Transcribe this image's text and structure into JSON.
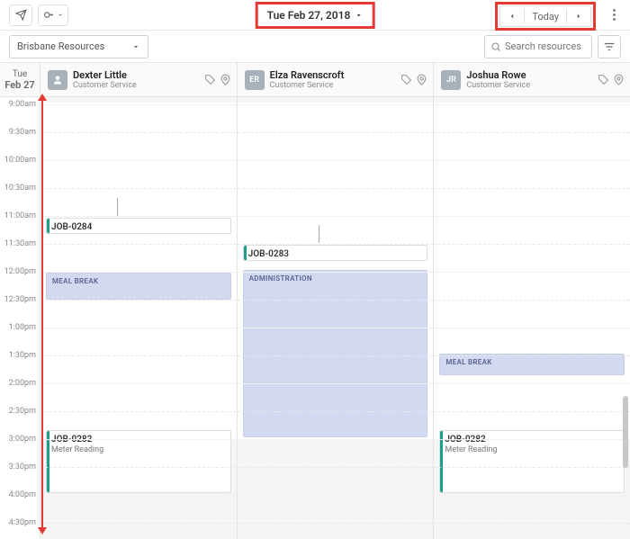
{
  "header": {
    "date_label": "Tue Feb 27, 2018",
    "today_label": "Today"
  },
  "filter": {
    "dropdown_label": "Brisbane Resources",
    "search_placeholder": "Search resources..."
  },
  "day": {
    "dow": "Tue",
    "date": "Feb 27"
  },
  "time_marks": [
    "9:00am",
    "9:30am",
    "10:00am",
    "10:30am",
    "11:00am",
    "11:30am",
    "12:00pm",
    "12:30pm",
    "1:00pm",
    "1:30pm",
    "2:00pm",
    "2:30pm",
    "3:00pm",
    "3:30pm",
    "4:00pm",
    "4:30pm"
  ],
  "resources": [
    {
      "name": "Dexter Little",
      "role": "Customer Service",
      "initials": "",
      "avatar": "person"
    },
    {
      "name": "Elza Ravenscroft",
      "role": "Customer Service",
      "initials": "ER",
      "avatar": "initials"
    },
    {
      "name": "Joshua Rowe",
      "role": "Customer Service",
      "initials": "JR",
      "avatar": "initials"
    }
  ],
  "events": {
    "col0": {
      "job": {
        "title": "JOB-0284"
      },
      "meal": {
        "label": "MEAL BREAK"
      },
      "job2": {
        "title": "JOB-0282",
        "sub": "Meter Reading"
      }
    },
    "col1": {
      "job": {
        "title": "JOB-0283"
      },
      "admin": {
        "label": "ADMINISTRATION"
      }
    },
    "col2": {
      "meal": {
        "label": "MEAL BREAK"
      },
      "job": {
        "title": "JOB-0282",
        "sub": "Meter Reading"
      }
    }
  }
}
